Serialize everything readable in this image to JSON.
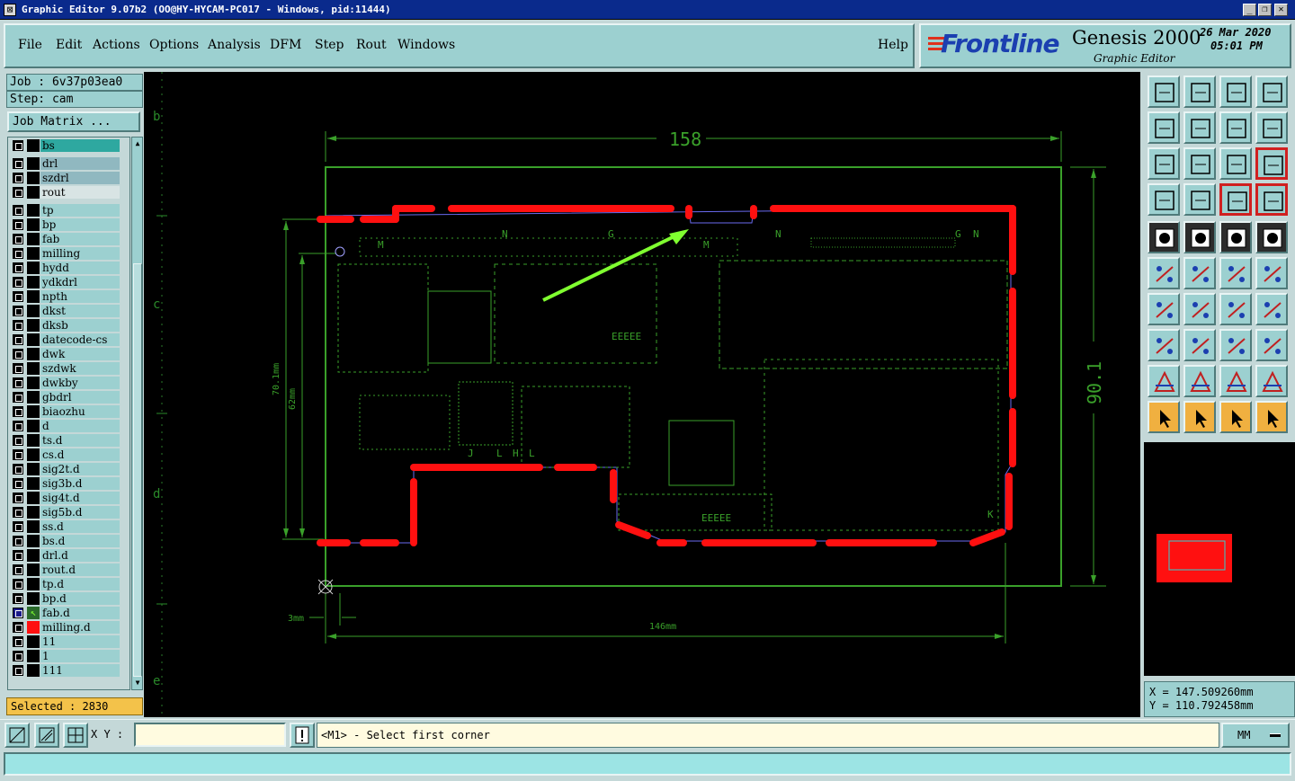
{
  "window": {
    "title": "Graphic Editor 9.07b2 (OO@HY-HYCAM-PC017 - Windows, pid:11444)",
    "controls": [
      "_",
      "❐",
      "✕"
    ]
  },
  "menu": {
    "items": [
      "File",
      "Edit",
      "Actions",
      "Options",
      "Analysis",
      "DFM",
      "Step",
      "Rout",
      "Windows"
    ],
    "help": "Help"
  },
  "brand": {
    "logo": "Frontline",
    "product": "Genesis 2000",
    "subtitle": "Graphic Editor",
    "date": "26 Mar 2020",
    "time": "05:01 PM"
  },
  "job": {
    "job_label": "Job : 6v37p03ea0",
    "step_label": "Step: cam",
    "matrix_button": "Job Matrix ..."
  },
  "layers": [
    {
      "name": "bs",
      "style": "bs"
    },
    {
      "name": "drl",
      "style": "drl"
    },
    {
      "name": "szdrl",
      "style": "drl"
    },
    {
      "name": "rout",
      "style": "rout"
    },
    {
      "name": "tp"
    },
    {
      "name": "bp"
    },
    {
      "name": "fab"
    },
    {
      "name": "milling"
    },
    {
      "name": "hydd"
    },
    {
      "name": "ydkdrl"
    },
    {
      "name": "npth"
    },
    {
      "name": "dkst"
    },
    {
      "name": "dksb"
    },
    {
      "name": "datecode-cs"
    },
    {
      "name": "dwk"
    },
    {
      "name": "szdwk"
    },
    {
      "name": "dwkby"
    },
    {
      "name": "gbdrl"
    },
    {
      "name": "biaozhu"
    },
    {
      "name": "d"
    },
    {
      "name": "ts.d"
    },
    {
      "name": "cs.d"
    },
    {
      "name": "sig2t.d"
    },
    {
      "name": "sig3b.d"
    },
    {
      "name": "sig4t.d"
    },
    {
      "name": "sig5b.d"
    },
    {
      "name": "ss.d"
    },
    {
      "name": "bs.d"
    },
    {
      "name": "drl.d"
    },
    {
      "name": "rout.d"
    },
    {
      "name": "tp.d"
    },
    {
      "name": "bp.d"
    },
    {
      "name": "fab.d",
      "style": "work"
    },
    {
      "name": "milling.d",
      "style": "affected"
    },
    {
      "name": "11"
    },
    {
      "name": "1"
    },
    {
      "name": "111"
    }
  ],
  "selected": "Selected : 2830",
  "canvas": {
    "ruler_left": [
      "b",
      "c",
      "d",
      "e"
    ],
    "dim_top": "158",
    "dim_right": "90.1",
    "dim_bottom": "146mm",
    "dim_left_outer": "70.1mm",
    "dim_left_inner": "62mm",
    "dim_small": "3mm",
    "colors": {
      "outline": "#3aa02a",
      "rout": "#ff1010",
      "features": "#3aa02a",
      "arrow": "#80ff30"
    }
  },
  "coords": {
    "x": "X  =  147.509260mm",
    "y": "Y  =  110.792458mm"
  },
  "bottom": {
    "xy_label": "X Y :",
    "xy_value": "",
    "prompt": "<M1> - Select first corner",
    "units": "MM"
  },
  "tools": [
    "zoom-home-icon",
    "zoom-back-icon",
    "zoom-window-icon",
    "zoom-area-icon",
    "pan-left-icon",
    "pan-right-icon",
    "pan-mirror-icon",
    "pan-flip-icon",
    "fit-vertical-icon",
    "fit-all-icon",
    "scale-one-to-two-icon",
    "help-icon",
    "snap-icon",
    "probe-icon",
    "grid-red-icon",
    "grid-red-2-icon",
    "fill-icon",
    "measure-area-icon",
    "ruler-icon",
    "circle-icon",
    "connect-nodes-icon",
    "cross-icon",
    "point-right-icon",
    "point-blue-icon",
    "line-red-icon",
    "line-blue-icon",
    "arc-icon",
    "ff-icon",
    "box-icon",
    "minus-icon",
    "center-icon",
    "group-icon",
    "triangle-icon",
    "triangle-2-icon",
    "triangle-3-icon",
    "triangle-4-icon",
    "select-icon",
    "select-2-icon",
    "select-3-icon",
    "select-4-icon"
  ]
}
